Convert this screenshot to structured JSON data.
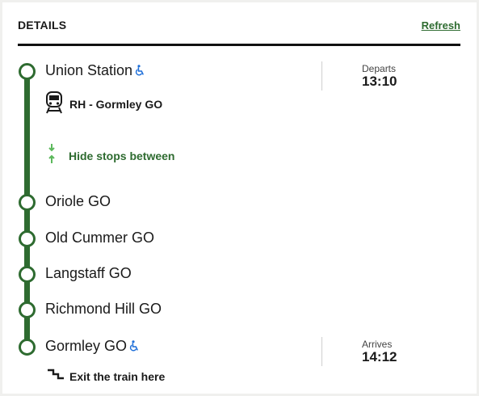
{
  "header": {
    "title": "DETAILS",
    "refresh_label": "Refresh"
  },
  "trip": {
    "route_label": "RH - Gormley GO",
    "toggle_label": "Hide stops between",
    "exit_label": "Exit the train here"
  },
  "stops": [
    {
      "name": "Union Station",
      "accessible": true,
      "time_label": "Departs",
      "time": "13:10"
    },
    {
      "name": "Oriole GO",
      "accessible": false
    },
    {
      "name": "Old Cummer GO",
      "accessible": false
    },
    {
      "name": "Langstaff GO",
      "accessible": false
    },
    {
      "name": "Richmond Hill GO",
      "accessible": false
    },
    {
      "name": "Gormley GO",
      "accessible": true,
      "time_label": "Arrives",
      "time": "14:12"
    }
  ],
  "colors": {
    "accent": "#2e6b30",
    "arrow_green": "#5cb85c",
    "access_blue": "#1e6fd9"
  },
  "icons": {
    "accessibility": "wheelchair-icon",
    "train": "train-icon",
    "toggle": "expand-collapse-arrows-icon",
    "exit": "exit-stairs-icon"
  }
}
